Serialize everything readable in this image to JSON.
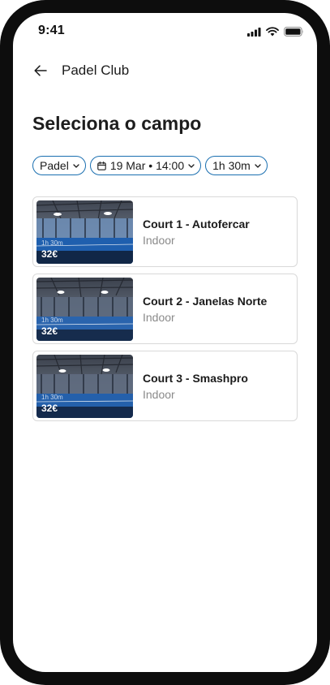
{
  "status_bar": {
    "time": "9:41",
    "icons": [
      "signal-icon",
      "wifi-icon",
      "battery-icon"
    ]
  },
  "header": {
    "back_icon": "arrow-left-icon",
    "title": "Padel Club"
  },
  "page_title": "Seleciona o campo",
  "filters": {
    "sport": {
      "label": "Padel",
      "icon": "chevron-down-icon"
    },
    "datetime": {
      "label": "19 Mar • 14:00",
      "icon": "calendar-icon"
    },
    "duration": {
      "label": "1h 30m",
      "icon": "chevron-down-icon"
    }
  },
  "courts": [
    {
      "name": "Court 1 - Autofercar",
      "type": "Indoor",
      "duration": "1h 30m",
      "price": "32€"
    },
    {
      "name": "Court 2 - Janelas Norte",
      "type": "Indoor",
      "duration": "1h 30m",
      "price": "32€"
    },
    {
      "name": "Court 3 - Smashpro",
      "type": "Indoor",
      "duration": "1h 30m",
      "price": "32€"
    }
  ],
  "colors": {
    "accent": "#1a6fb0",
    "court_blue": "#1f5fae",
    "text_primary": "#1b1b1b",
    "text_secondary": "#8a8a8a",
    "card_border": "#d9d9d9",
    "frame": "#0d0d0d"
  }
}
